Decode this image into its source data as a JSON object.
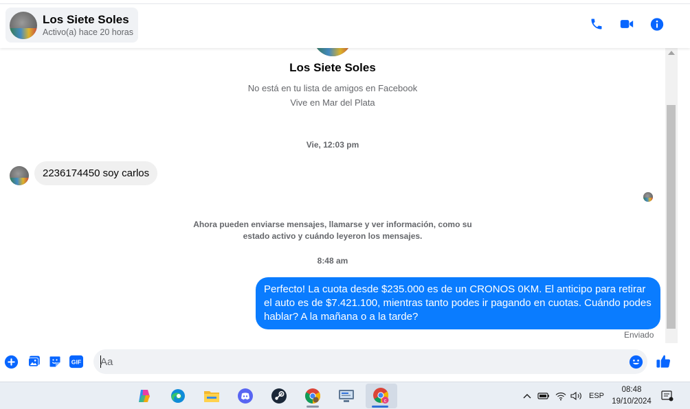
{
  "header": {
    "contact_name": "Los Siete Soles",
    "contact_status": "Activo(a) hace 20 horas"
  },
  "profile": {
    "name": "Los Siete Soles",
    "friend_note": "No está en tu lista de amigos en Facebook",
    "location": "Vive en Mar del Plata"
  },
  "thread": {
    "timestamp_1": "Vie, 12:03 pm",
    "incoming_message": "2236174450 soy carlos",
    "info_note": "Ahora pueden enviarse mensajes, llamarse y ver información, como su estado activo y cuándo leyeron los mensajes.",
    "timestamp_2": "8:48 am",
    "outgoing_message": "Perfecto! La cuota desde $235.000 es de un CRONOS 0KM. El anticipo para retirar el auto es de $7.421.100, mientras tanto podes ir pagando en cuotas. Cuándo podes hablar? A la mañana o a la tarde?",
    "sent_status": "Enviado"
  },
  "composer": {
    "placeholder": "Aa",
    "gif_label": "GIF"
  },
  "taskbar": {
    "apps": [
      "copilot-icon",
      "edge-icon",
      "file-explorer-icon",
      "discord-icon",
      "steam-icon",
      "chrome-icon",
      "remote-desktop-icon",
      "chrome-profile-icon"
    ],
    "language": "ESP",
    "time": "08:48",
    "date": "19/10/2024"
  },
  "colors": {
    "messenger_blue": "#0a7cff",
    "icon_blue": "#0866ff",
    "incoming_bubble": "#f0f0f0",
    "secondary_text": "#65676b"
  }
}
